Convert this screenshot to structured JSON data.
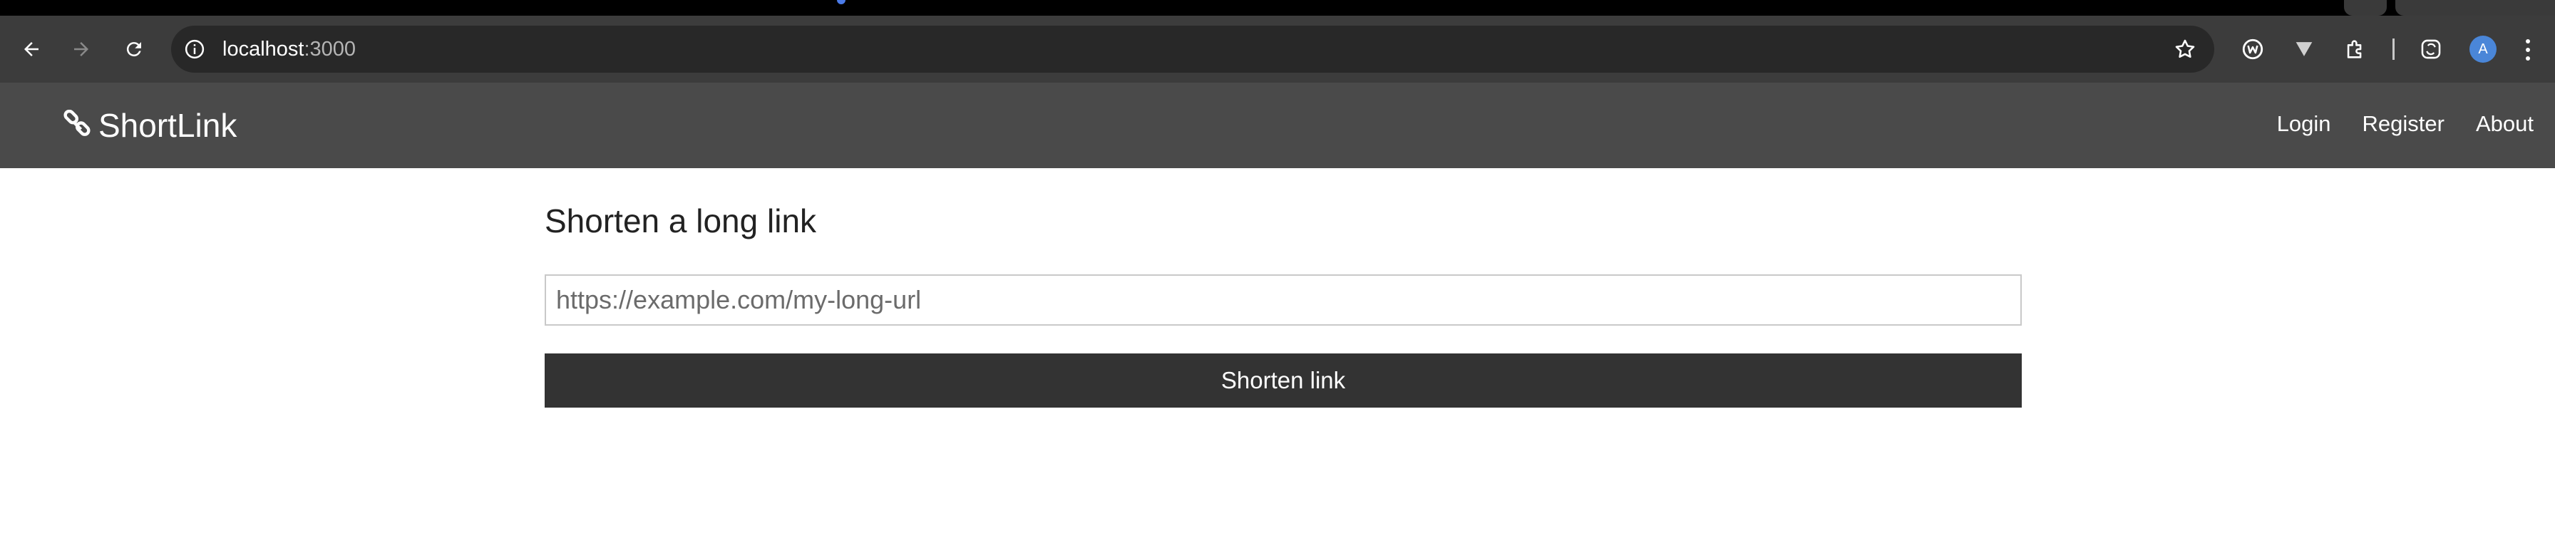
{
  "browser": {
    "url_host": "localhost",
    "url_port": ":3000",
    "avatar_letter": "A",
    "icons": [
      "back-icon",
      "forward-icon",
      "reload-icon",
      "site-info-icon",
      "bookmark-star-icon",
      "extension-w-icon",
      "extension-v-icon",
      "extensions-puzzle-icon",
      "extension-sync-icon",
      "profile-avatar",
      "more-menu-icon"
    ]
  },
  "site": {
    "brand": "ShortLink",
    "nav": [
      "Login",
      "Register",
      "About"
    ]
  },
  "main": {
    "heading": "Shorten a long link",
    "input_placeholder": "https://example.com/my-long-url",
    "input_value": "",
    "button_label": "Shorten link"
  },
  "colors": {
    "navbar": "#4a4a4a",
    "button": "#333333",
    "browser_toolbar": "#3c3c3c"
  }
}
